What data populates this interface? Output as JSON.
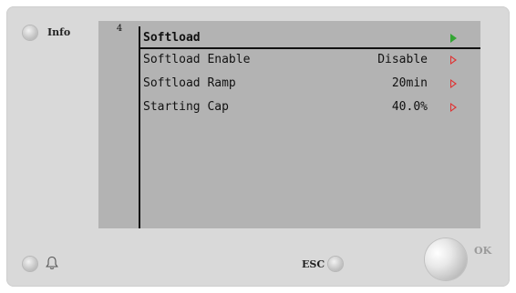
{
  "header": {
    "info_label": "Info"
  },
  "screen": {
    "page_number": "4",
    "title": "Softload",
    "rows": [
      {
        "label": "Softload Enable",
        "value": "Disable"
      },
      {
        "label": "Softload Ramp",
        "value": "20min"
      },
      {
        "label": "Starting Cap",
        "value": "40.0%"
      }
    ]
  },
  "footer": {
    "esc_label": "ESC",
    "ok_label": "OK"
  },
  "colors": {
    "panel": "#d9d9d9",
    "screen": "#b3b3b3",
    "active_arrow": "#33a533",
    "edit_arrow": "#e03030"
  },
  "icons": {
    "alarm": "bell-icon"
  }
}
